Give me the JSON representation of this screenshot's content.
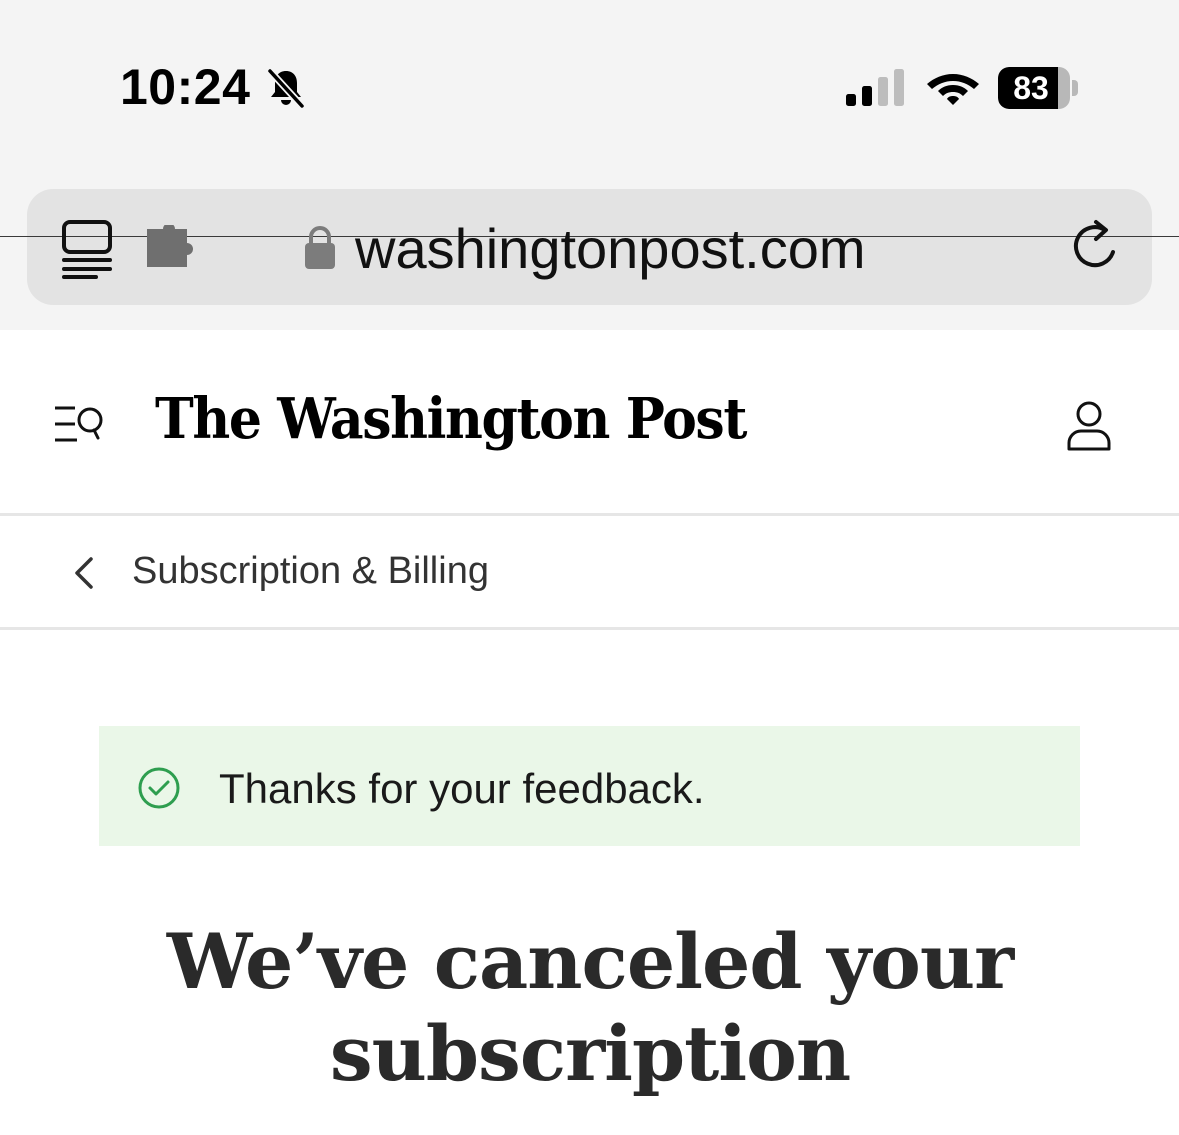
{
  "status_bar": {
    "time": "10:24",
    "battery_percent": "83",
    "battery_level": 0.83,
    "icons": [
      "bell-slash-icon",
      "cellular-signal-icon",
      "wifi-icon",
      "battery-icon"
    ]
  },
  "browser": {
    "url": "washingtonpost.com",
    "icons": [
      "reader-mode-icon",
      "extension-icon",
      "lock-icon",
      "reload-icon"
    ]
  },
  "site_header": {
    "logo_text": "The Washington Post",
    "icons": [
      "menu-search-icon",
      "account-icon"
    ]
  },
  "breadcrumb": {
    "label": "Subscription & Billing",
    "icon": "chevron-left-icon"
  },
  "alert": {
    "message": "Thanks for your feedback.",
    "icon": "check-circle-icon",
    "background_color": "#eaf7e8",
    "icon_color": "#2e9e4f"
  },
  "main": {
    "headline_line1": "We’ve canceled your",
    "headline_line2": "subscription"
  }
}
